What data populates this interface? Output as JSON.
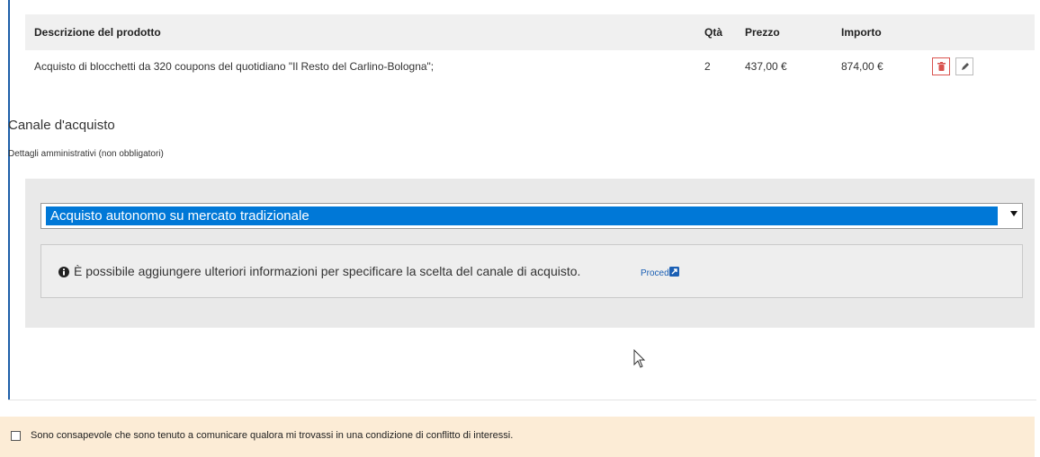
{
  "table": {
    "headers": {
      "descrizione": "Descrizione del prodotto",
      "qta": "Qtà",
      "prezzo": "Prezzo",
      "importo": "Importo"
    },
    "rows": [
      {
        "descrizione": "Acquisto di blocchetti da 320 coupons del quotidiano \"Il Resto del Carlino-Bologna\";",
        "qta": "2",
        "prezzo": "437,00 €",
        "importo": "874,00 €"
      }
    ]
  },
  "canale": {
    "title": "Canale d'acquisto",
    "subtitle": "Dettagli amministrativi (non obbligatori)",
    "select_value": "Acquisto autonomo su mercato tradizionale",
    "info_text": "È possibile aggiungere ulteriori informazioni per specificare la scelta del canale di acquisto.",
    "procedi_label": "Procedi"
  },
  "consent": {
    "label": "Sono consapevole che sono tenuto a comunicare qualora mi trovassi in una condizione di conflitto di interessi."
  },
  "colors": {
    "accent": "#1d5fa8",
    "select_highlight": "#0078d7",
    "delete": "#d9534f",
    "consent_bg": "#fcecd6"
  }
}
